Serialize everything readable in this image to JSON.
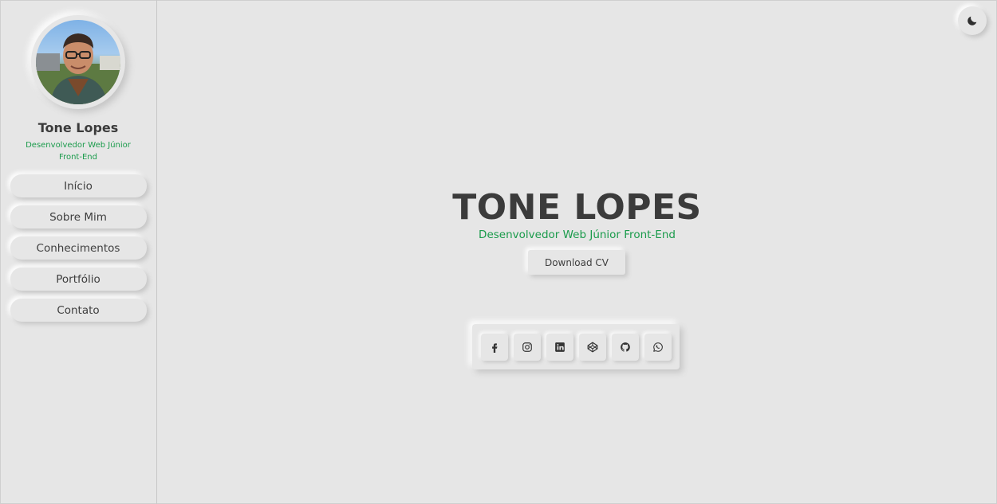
{
  "sidebar": {
    "name": "Tone Lopes",
    "role": "Desenvolvedor Web Júnior Front-End",
    "nav": [
      {
        "label": "Início"
      },
      {
        "label": "Sobre Mim"
      },
      {
        "label": "Conhecimentos"
      },
      {
        "label": "Portfólio"
      },
      {
        "label": "Contato"
      }
    ]
  },
  "hero": {
    "title": "TONE LOPES",
    "role": "Desenvolvedor Web Júnior Front-End",
    "cv_label": "Download CV"
  },
  "social": [
    {
      "icon": "facebook-icon"
    },
    {
      "icon": "instagram-icon"
    },
    {
      "icon": "linkedin-icon"
    },
    {
      "icon": "codepen-icon"
    },
    {
      "icon": "github-icon"
    },
    {
      "icon": "whatsapp-icon"
    }
  ],
  "theme_toggle": {
    "icon": "moon-icon"
  },
  "colors": {
    "background": "#e6e6e6",
    "accent": "#1a9b4b",
    "text": "#3b3b3b"
  }
}
